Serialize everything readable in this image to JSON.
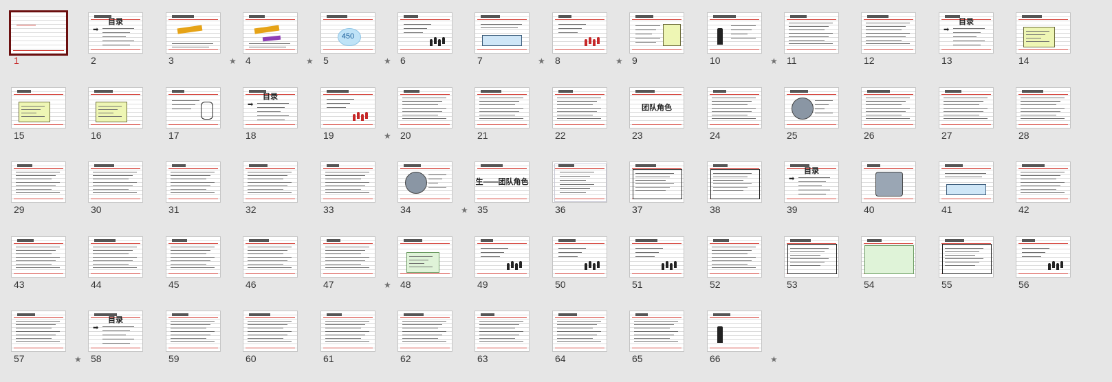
{
  "view": "slide-sorter",
  "selected_slide": 1,
  "colors": {
    "background": "#e6e6e6",
    "selection_border": "#6b0f0f",
    "accent_red": "#d6453d",
    "number_selected": "#c62828",
    "star": "#707070"
  },
  "star_glyph": "★",
  "slides": [
    {
      "number": "1",
      "star": false,
      "kind": "title"
    },
    {
      "number": "2",
      "star": false,
      "kind": "toc",
      "title": "目录"
    },
    {
      "number": "3",
      "star": true,
      "kind": "wordart"
    },
    {
      "number": "4",
      "star": true,
      "kind": "wordart2"
    },
    {
      "number": "5",
      "star": true,
      "kind": "burst",
      "title": "450"
    },
    {
      "number": "6",
      "star": false,
      "kind": "figures"
    },
    {
      "number": "7",
      "star": true,
      "kind": "bluebox"
    },
    {
      "number": "8",
      "star": true,
      "kind": "people"
    },
    {
      "number": "9",
      "star": false,
      "kind": "diagram"
    },
    {
      "number": "10",
      "star": true,
      "kind": "silhouette"
    },
    {
      "number": "11",
      "star": false,
      "kind": "text"
    },
    {
      "number": "12",
      "star": false,
      "kind": "text"
    },
    {
      "number": "13",
      "star": false,
      "kind": "toc",
      "title": "目录"
    },
    {
      "number": "14",
      "star": false,
      "kind": "yellowbox"
    },
    {
      "number": "15",
      "star": false,
      "kind": "yellowbox"
    },
    {
      "number": "16",
      "star": false,
      "kind": "yellowbox"
    },
    {
      "number": "17",
      "star": false,
      "kind": "cylinder"
    },
    {
      "number": "18",
      "star": false,
      "kind": "toc",
      "title": "目录"
    },
    {
      "number": "19",
      "star": true,
      "kind": "people"
    },
    {
      "number": "20",
      "star": false,
      "kind": "text"
    },
    {
      "number": "21",
      "star": false,
      "kind": "text"
    },
    {
      "number": "22",
      "star": false,
      "kind": "text"
    },
    {
      "number": "23",
      "star": false,
      "kind": "heading",
      "title": "团队角色"
    },
    {
      "number": "24",
      "star": false,
      "kind": "text"
    },
    {
      "number": "25",
      "star": false,
      "kind": "wheel"
    },
    {
      "number": "26",
      "star": false,
      "kind": "text"
    },
    {
      "number": "27",
      "star": false,
      "kind": "text"
    },
    {
      "number": "28",
      "star": false,
      "kind": "text"
    },
    {
      "number": "29",
      "star": false,
      "kind": "text"
    },
    {
      "number": "30",
      "star": false,
      "kind": "text"
    },
    {
      "number": "31",
      "star": false,
      "kind": "text"
    },
    {
      "number": "32",
      "star": false,
      "kind": "text"
    },
    {
      "number": "33",
      "star": false,
      "kind": "text"
    },
    {
      "number": "34",
      "star": true,
      "kind": "wheel"
    },
    {
      "number": "35",
      "star": false,
      "kind": "heading",
      "title": "生——团队角色"
    },
    {
      "number": "36",
      "star": false,
      "kind": "sketch"
    },
    {
      "number": "37",
      "star": false,
      "kind": "darkbox"
    },
    {
      "number": "38",
      "star": false,
      "kind": "darkbox"
    },
    {
      "number": "39",
      "star": false,
      "kind": "toc",
      "title": "目录"
    },
    {
      "number": "40",
      "star": false,
      "kind": "hexagon"
    },
    {
      "number": "41",
      "star": false,
      "kind": "bluebox"
    },
    {
      "number": "42",
      "star": false,
      "kind": "text"
    },
    {
      "number": "43",
      "star": false,
      "kind": "text"
    },
    {
      "number": "44",
      "star": false,
      "kind": "text"
    },
    {
      "number": "45",
      "star": false,
      "kind": "text"
    },
    {
      "number": "46",
      "star": false,
      "kind": "text"
    },
    {
      "number": "47",
      "star": true,
      "kind": "text"
    },
    {
      "number": "48",
      "star": false,
      "kind": "greenbox"
    },
    {
      "number": "49",
      "star": false,
      "kind": "figures"
    },
    {
      "number": "50",
      "star": false,
      "kind": "figures"
    },
    {
      "number": "51",
      "star": false,
      "kind": "figures"
    },
    {
      "number": "52",
      "star": false,
      "kind": "text"
    },
    {
      "number": "53",
      "star": false,
      "kind": "darkbox"
    },
    {
      "number": "54",
      "star": false,
      "kind": "greenfull"
    },
    {
      "number": "55",
      "star": false,
      "kind": "darkbox"
    },
    {
      "number": "56",
      "star": false,
      "kind": "figures"
    },
    {
      "number": "57",
      "star": true,
      "kind": "text"
    },
    {
      "number": "58",
      "star": false,
      "kind": "toc",
      "title": "目录"
    },
    {
      "number": "59",
      "star": false,
      "kind": "text"
    },
    {
      "number": "60",
      "star": false,
      "kind": "text"
    },
    {
      "number": "61",
      "star": false,
      "kind": "text"
    },
    {
      "number": "62",
      "star": false,
      "kind": "text"
    },
    {
      "number": "63",
      "star": false,
      "kind": "text"
    },
    {
      "number": "64",
      "star": false,
      "kind": "text"
    },
    {
      "number": "65",
      "star": false,
      "kind": "text"
    },
    {
      "number": "66",
      "star": true,
      "kind": "silhouette"
    }
  ]
}
